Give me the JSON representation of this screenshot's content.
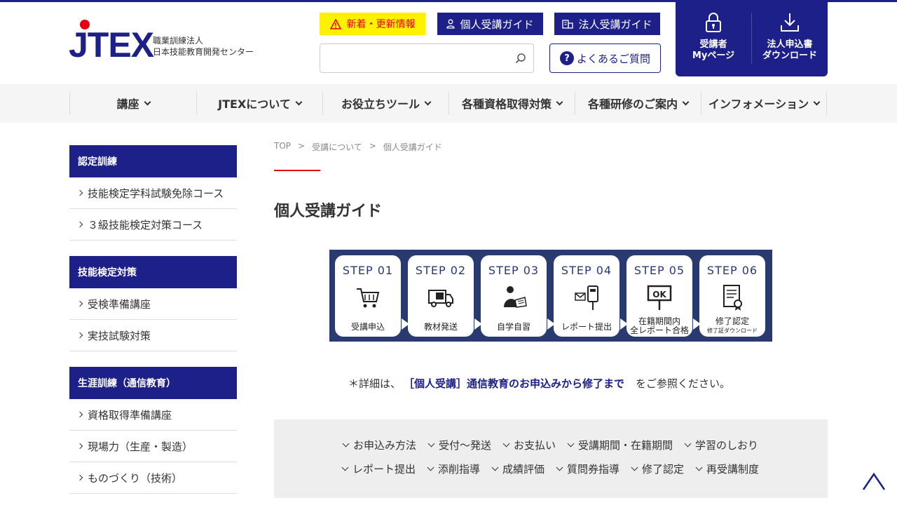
{
  "header": {
    "logo_text": "JTEX",
    "org_line1": "職業訓練法人",
    "org_line2": "日本技能教育開発センター",
    "news_label": "新着・更新情報",
    "personal_guide_label": "個人受講ガイド",
    "corporate_guide_label": "法人受講ガイド",
    "search_placeholder": "",
    "faq_label": "よくあるご質問",
    "mypage_line1": "受講者",
    "mypage_line2": "Myページ",
    "download_line1": "法人申込書",
    "download_line2": "ダウンロード"
  },
  "nav": {
    "items": [
      {
        "label": "講座"
      },
      {
        "label": "JTEXについて"
      },
      {
        "label": "お役立ちツール"
      },
      {
        "label": "各種資格取得対策"
      },
      {
        "label": "各種研修のご案内"
      },
      {
        "label": "インフォメーション"
      }
    ]
  },
  "sidebar": {
    "groups": [
      {
        "title": "認定訓練",
        "links": [
          "技能検定学科試験免除コース",
          "３級技能検定対策コース"
        ]
      },
      {
        "title": "技能検定対策",
        "links": [
          "受検準備講座",
          "実技試験対策"
        ]
      },
      {
        "title": "生涯訓練（通信教育）",
        "links": [
          "資格取得準備講座",
          "現場力（生産・製造）",
          "ものづくり（技術）"
        ]
      }
    ]
  },
  "breadcrumb": {
    "top": "TOP",
    "sep": ">",
    "level1": "受講について",
    "level2": "個人受講ガイド"
  },
  "page": {
    "title": "個人受講ガイド"
  },
  "steps": [
    {
      "no": "STEP 01",
      "cap": "受講申込",
      "cap2": "",
      "icon": "cart-icon"
    },
    {
      "no": "STEP 02",
      "cap": "教材発送",
      "cap2": "",
      "icon": "truck-icon"
    },
    {
      "no": "STEP 03",
      "cap": "自学自習",
      "cap2": "",
      "icon": "study-icon"
    },
    {
      "no": "STEP 04",
      "cap": "レポート提出",
      "cap2": "",
      "icon": "mailbox-icon"
    },
    {
      "no": "STEP 05",
      "cap": "在籍期間内",
      "cap2": "全レポート合格",
      "icon": "ok-sign-icon"
    },
    {
      "no": "STEP 06",
      "cap": "修了認定",
      "cap2": "修了証ダウンロード",
      "icon": "certificate-icon"
    }
  ],
  "note": {
    "prefix": "＊詳細は、",
    "link": "［個人受講］通信教育のお申込みから修了まで",
    "suffix": "をご参照ください。"
  },
  "anchors": {
    "row1": [
      "お申込み方法",
      "受付～発送",
      "お支払い",
      "受講期間・在籍期間",
      "学習のしおり"
    ],
    "row2": [
      "レポート提出",
      "添削指導",
      "成績評価",
      "質問券指導",
      "修了認定",
      "再受講制度"
    ]
  },
  "colors": {
    "brand_navy": "#1d2088",
    "accent_red": "#e60012",
    "news_yellow": "#fff100",
    "steps_bg": "#283a70"
  }
}
